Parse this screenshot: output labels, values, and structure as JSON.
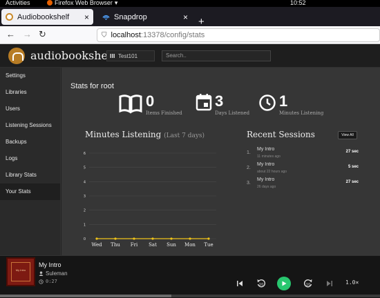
{
  "os_bar": {
    "activities": "Activities",
    "app": "Firefox Web Browser",
    "clock": "10:52"
  },
  "browser": {
    "tabs": [
      {
        "label": "Audiobookshelf",
        "close": "×"
      },
      {
        "label": "Snapdrop",
        "close": "×"
      }
    ],
    "new_tab": "+",
    "url_host": "localhost",
    "url_path": ":13378/config/stats"
  },
  "header": {
    "brand": "audiobookshelf",
    "library": "Test101",
    "search_placeholder": "Search.."
  },
  "sidebar": {
    "items": [
      {
        "label": "Settings"
      },
      {
        "label": "Libraries"
      },
      {
        "label": "Users"
      },
      {
        "label": "Listening Sessions"
      },
      {
        "label": "Backups"
      },
      {
        "label": "Logs"
      },
      {
        "label": "Library Stats"
      },
      {
        "label": "Your Stats"
      }
    ]
  },
  "stats": {
    "title": "Stats for root",
    "items_finished": {
      "value": "0",
      "label": "Items Finished"
    },
    "days_listened": {
      "value": "3",
      "label": "Days Listened"
    },
    "minutes_listening": {
      "value": "1",
      "label": "Minutes Listening"
    }
  },
  "chart_section": {
    "title": "Minutes Listening",
    "subtitle": "(Last 7 days)"
  },
  "chart_data": {
    "type": "line",
    "categories": [
      "Wed",
      "Thu",
      "Fri",
      "Sat",
      "Sun",
      "Mon",
      "Tue"
    ],
    "values": [
      0,
      0,
      0,
      0,
      0,
      0,
      0
    ],
    "yticks": [
      "0",
      "1",
      "2",
      "3",
      "4",
      "5",
      "6"
    ],
    "ylim": [
      0,
      6
    ],
    "grid": true,
    "line_color": "#f0c419",
    "grid_color": "#4a4a4a"
  },
  "recent_sessions": {
    "title": "Recent Sessions",
    "view_all": "View All",
    "items": [
      {
        "index": "1.",
        "title": "My Intro",
        "ago": "11 minutes ago",
        "duration": "27 sec"
      },
      {
        "index": "2.",
        "title": "My Intro",
        "ago": "about 22 hours ago",
        "duration": "5 sec"
      },
      {
        "index": "3.",
        "title": "My Intro",
        "ago": "26 days ago",
        "duration": "27 sec"
      }
    ]
  },
  "player": {
    "title": "My Intro",
    "author": "Suleman",
    "time": "0:27",
    "cover_text": "My Intro",
    "speed": "1.0×",
    "progress": 0.45
  },
  "colors": {
    "accent_green": "#28c76f",
    "chart_yellow": "#f0c419"
  }
}
